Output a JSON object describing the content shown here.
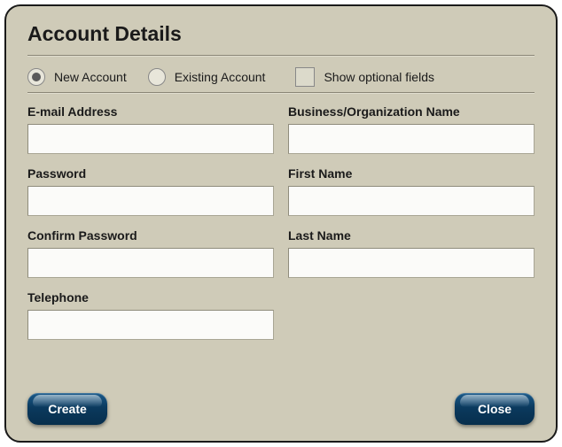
{
  "title": "Account Details",
  "options": {
    "new_account": "New Account",
    "existing_account": "Existing Account",
    "show_optional": "Show optional fields",
    "account_type_selected": "new",
    "show_optional_checked": false
  },
  "fields": {
    "email": {
      "label": "E-mail Address",
      "value": ""
    },
    "business": {
      "label": "Business/Organization Name",
      "value": ""
    },
    "password": {
      "label": "Password",
      "value": ""
    },
    "first_name": {
      "label": "First Name",
      "value": ""
    },
    "confirm_password": {
      "label": "Confirm Password",
      "value": ""
    },
    "last_name": {
      "label": "Last Name",
      "value": ""
    },
    "telephone": {
      "label": "Telephone",
      "value": ""
    }
  },
  "buttons": {
    "create": "Create",
    "close": "Close"
  }
}
